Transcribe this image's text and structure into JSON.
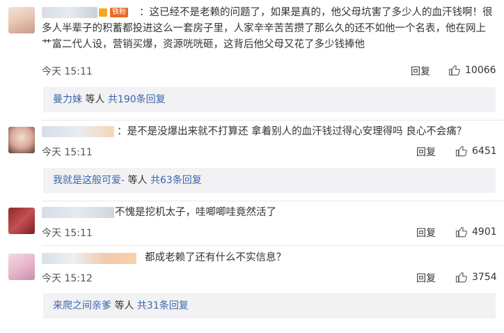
{
  "comments": [
    {
      "text": "：这已经不是老赖的问题了，如果是真的，他父母坑害了多少人的血汗钱啊！很多人半辈子的积蓄都投进这么一套房子里，人家辛辛苦苦攒了那么久的还不如他一个名表，他在网上艹富二代人设，营销买爆，资源咣咣砸，这背后他父母又花了多少钱捧他",
      "badge": "铁粉",
      "time": "今天 15:11",
      "reply": "回复",
      "likes": "10066",
      "sub": {
        "name": "曼力妹",
        "mid": " 等人 ",
        "count": "共190条回复"
      }
    },
    {
      "text": "：是不是没爆出来就不打算还 拿着别人的血汗钱过得心安理得吗 良心不会痛？",
      "time": "今天 15:11",
      "reply": "回复",
      "likes": "6451",
      "sub": {
        "name": "我就是这般可爱-",
        "mid": " 等人 ",
        "count": "共63条回复"
      }
    },
    {
      "text": "不愧是挖机太子，哇唧唧哇竟然活了",
      "time": "今天 15:11",
      "reply": "回复",
      "likes": "4901"
    },
    {
      "text": "都成老赖了还有什么不实信息？",
      "time": "今天 15:12",
      "reply": "回复",
      "likes": "3754",
      "sub": {
        "name": "来爬之间亲爹",
        "mid": " 等人 ",
        "count": "共31条回复"
      }
    }
  ],
  "icons": {
    "like": "thumbs-up-icon"
  },
  "colors": {
    "link": "#3b66a8",
    "sub_bg": "#f2f2f5",
    "badge": "#e86b2c"
  }
}
